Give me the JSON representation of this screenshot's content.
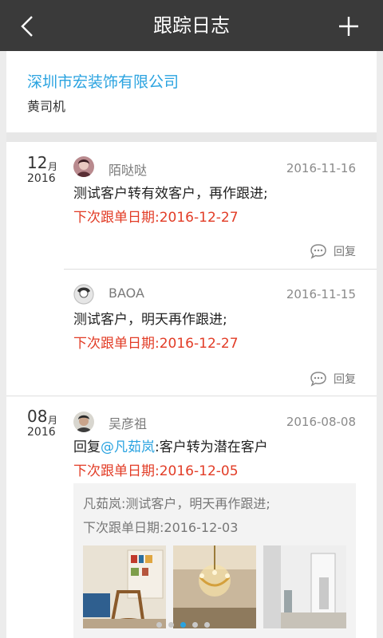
{
  "nav": {
    "title": "跟踪日志",
    "back_icon": "chevron-left-icon",
    "add_icon": "plus-icon"
  },
  "company": {
    "name": "深圳市宏装饰有限公司",
    "contact": "黄司机"
  },
  "groups": [
    {
      "day": "12",
      "month_suffix": "月",
      "year": "2016",
      "entries": [
        {
          "author": "陌哒哒",
          "date": "2016-11-16",
          "text": "测试客户转有效客户，再作跟进;",
          "next_follow": "下次跟单日期:2016-12-27",
          "reply_label": "回复"
        },
        {
          "author": "BAOA",
          "date": "2016-11-15",
          "text": "测试客户，明天再作跟进;",
          "next_follow": "下次跟单日期:2016-12-27",
          "reply_label": "回复"
        }
      ]
    },
    {
      "day": "08",
      "month_suffix": "月",
      "year": "2016",
      "entries": [
        {
          "author": "吴彦祖",
          "date": "2016-08-08",
          "reply_prefix": "回复",
          "mention": "@凡茹岚",
          "text": ":客户转为潜在客户",
          "next_follow": "下次跟单日期:2016-12-05",
          "quote": {
            "text": "凡茹岚:测试客户，明天再作跟进;",
            "next_follow": "下次跟单日期:2016-12-03"
          }
        }
      ]
    }
  ],
  "carousel": {
    "total": 5,
    "active_index": 2
  },
  "colors": {
    "navbar": "#3a3a3a",
    "link_blue": "#2aa3e0",
    "alert_red": "#e23c26"
  }
}
